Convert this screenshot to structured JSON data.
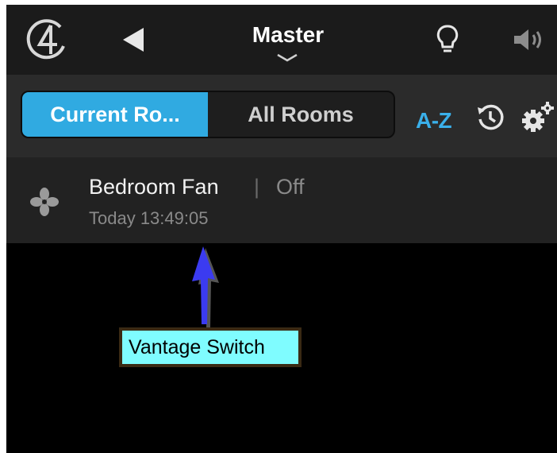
{
  "header": {
    "title": "Master",
    "icons": [
      "control4-logo-icon",
      "back-arrow-icon",
      "chevron-down-icon",
      "lightbulb-icon",
      "speaker-icon"
    ]
  },
  "filter": {
    "tabs": [
      {
        "label": "Current Ro...",
        "selected": true
      },
      {
        "label": "All Rooms",
        "selected": false
      }
    ],
    "sort_label": "A-Z",
    "icons": [
      "history-icon",
      "settings-gear-icon"
    ]
  },
  "device": {
    "name": "Bedroom Fan",
    "separator": "|",
    "status": "Off",
    "timestamp": "Today 13:49:05",
    "icon": "fan-icon"
  },
  "annotation": {
    "label": "Vantage Switch",
    "arrow_icon": "up-arrow-icon"
  },
  "colors": {
    "accent": "#30aae1",
    "callout_bg": "#7ffcff",
    "arrow": "#3b3bf0"
  }
}
